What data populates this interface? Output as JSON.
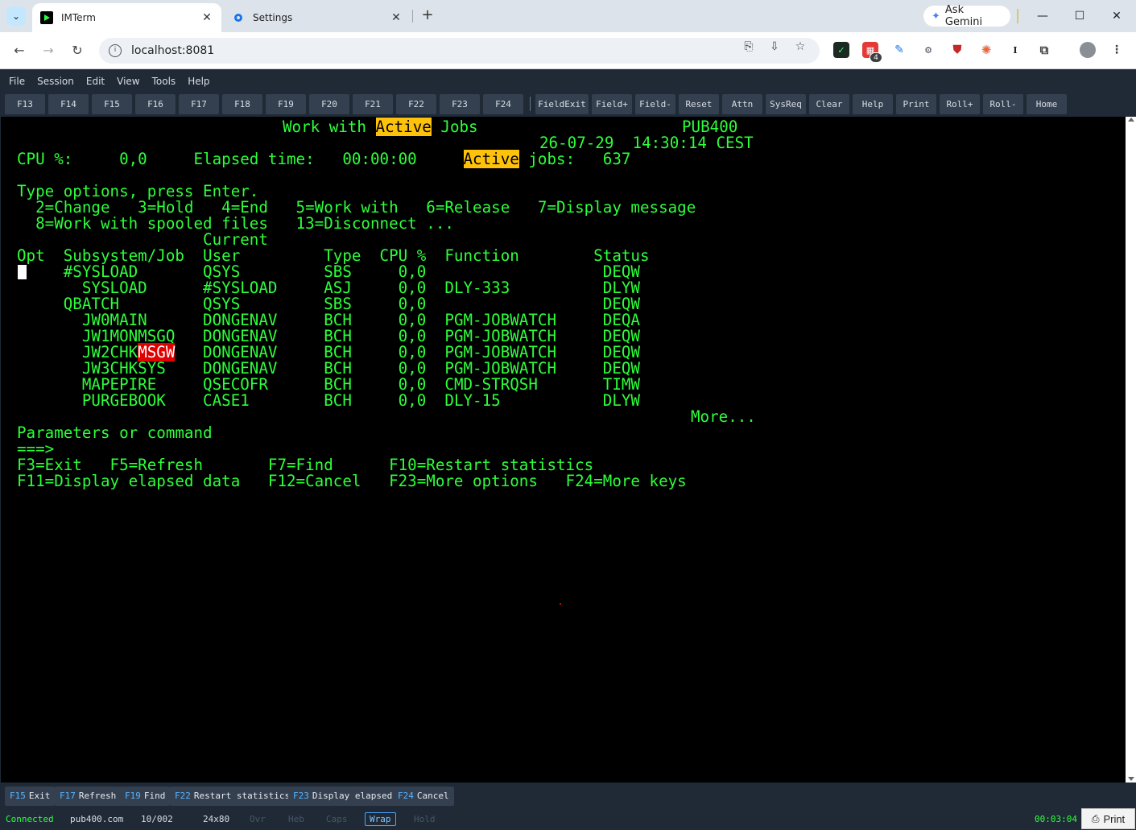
{
  "browser": {
    "tabs": [
      {
        "title": "IMTerm",
        "icon": "terminal-icon"
      },
      {
        "title": "Settings",
        "icon": "gear-icon"
      }
    ],
    "gemini_label": "Ask Gemini",
    "url": "localhost:8081",
    "extension_badge": "4"
  },
  "app": {
    "menu": [
      "File",
      "Session",
      "Edit",
      "View",
      "Tools",
      "Help"
    ],
    "function_keys": [
      "F13",
      "F14",
      "F15",
      "F16",
      "F17",
      "F18",
      "F19",
      "F20",
      "F21",
      "F22",
      "F23",
      "F24"
    ],
    "action_keys": [
      "FieldExit",
      "Field+",
      "Field-",
      "Reset",
      "Attn",
      "SysReq",
      "Clear",
      "Help",
      "Print",
      "Roll+",
      "Roll-",
      "Home"
    ]
  },
  "screen": {
    "title_pre": "Work with ",
    "title_hl": "Active",
    "title_post": " Jobs",
    "system": "PUB400",
    "datetime": "26-07-29  14:30:14 CEST",
    "stats_pre": "CPU %:     0,0     Elapsed time:   00:00:00     ",
    "stats_hl": "Active",
    "stats_post": " jobs:   637",
    "instruction": "Type options, press Enter.",
    "options_1": "  2=Change   3=Hold   4=End   5=Work with   6=Release   7=Display message",
    "options_2": "  8=Work with spooled files   13=Disconnect ...",
    "header_1": "                    Current",
    "header_2": "Opt  Subsystem/Job  User         Type  CPU %  Function        Status",
    "rows": [
      {
        "indent": "     ",
        "job": "#SYSLOAD",
        "job_hl": "",
        "user": "QSYS",
        "type": "SBS",
        "cpu": "0,0",
        "function": "",
        "status": "DEQW"
      },
      {
        "indent": "       ",
        "job": "SYSLOAD",
        "job_hl": "",
        "user": "#SYSLOAD",
        "type": "ASJ",
        "cpu": "0,0",
        "function": "DLY-333",
        "status": "DLYW"
      },
      {
        "indent": "     ",
        "job": "QBATCH",
        "job_hl": "",
        "user": "QSYS",
        "type": "SBS",
        "cpu": "0,0",
        "function": "",
        "status": "DEQW"
      },
      {
        "indent": "       ",
        "job": "JW0MAIN",
        "job_hl": "",
        "user": "DONGENAV",
        "type": "BCH",
        "cpu": "0,0",
        "function": "PGM-JOBWATCH",
        "status": "DEQA"
      },
      {
        "indent": "       ",
        "job": "JW1MONMSGQ",
        "job_hl": "",
        "user": "DONGENAV",
        "type": "BCH",
        "cpu": "0,0",
        "function": "PGM-JOBWATCH",
        "status": "DEQW"
      },
      {
        "indent": "       ",
        "job": "JW2CHK",
        "job_hl": "MSGW",
        "user": "DONGENAV",
        "type": "BCH",
        "cpu": "0,0",
        "function": "PGM-JOBWATCH",
        "status": "DEQW"
      },
      {
        "indent": "       ",
        "job": "JW3CHKSYS",
        "job_hl": "",
        "user": "DONGENAV",
        "type": "BCH",
        "cpu": "0,0",
        "function": "PGM-JOBWATCH",
        "status": "DEQW"
      },
      {
        "indent": "       ",
        "job": "MAPEPIRE",
        "job_hl": "",
        "user": "QSECOFR",
        "type": "BCH",
        "cpu": "0,0",
        "function": "CMD-STRQSH",
        "status": "TIMW"
      },
      {
        "indent": "       ",
        "job": "PURGEBOOK",
        "job_hl": "",
        "user": "CASE1",
        "type": "BCH",
        "cpu": "0,0",
        "function": "DLY-15",
        "status": "DLYW"
      }
    ],
    "more": "More...",
    "params_label": "Parameters or command",
    "prompt": "===>",
    "keys_1": "F3=Exit   F5=Refresh       F7=Find      F10=Restart statistics",
    "keys_2": "F11=Display elapsed data   F12=Cancel   F23=More options   F24=More keys"
  },
  "fbar": [
    {
      "key": "F15",
      "label": "Exit"
    },
    {
      "key": "F17",
      "label": "Refresh"
    },
    {
      "key": "F19",
      "label": "Find"
    },
    {
      "key": "F22",
      "label": "Restart statistics"
    },
    {
      "key": "F23",
      "label": "Display elapsed"
    },
    {
      "key": "F24",
      "label": "Cancel"
    }
  ],
  "status": {
    "connection": "Connected",
    "host": "pub400.com",
    "cursor": "10/002",
    "size": "24x80",
    "ovr": "Ovr",
    "heb": "Heb",
    "caps": "Caps",
    "wrap": "Wrap",
    "hold": "Hold",
    "timer": "00:03:04",
    "print": "Print"
  },
  "colors": {
    "terminal_text": "#2dff3a",
    "highlight_yellow": "#ffc20a",
    "highlight_red": "#e00000",
    "ui_background": "#1f2a36"
  }
}
